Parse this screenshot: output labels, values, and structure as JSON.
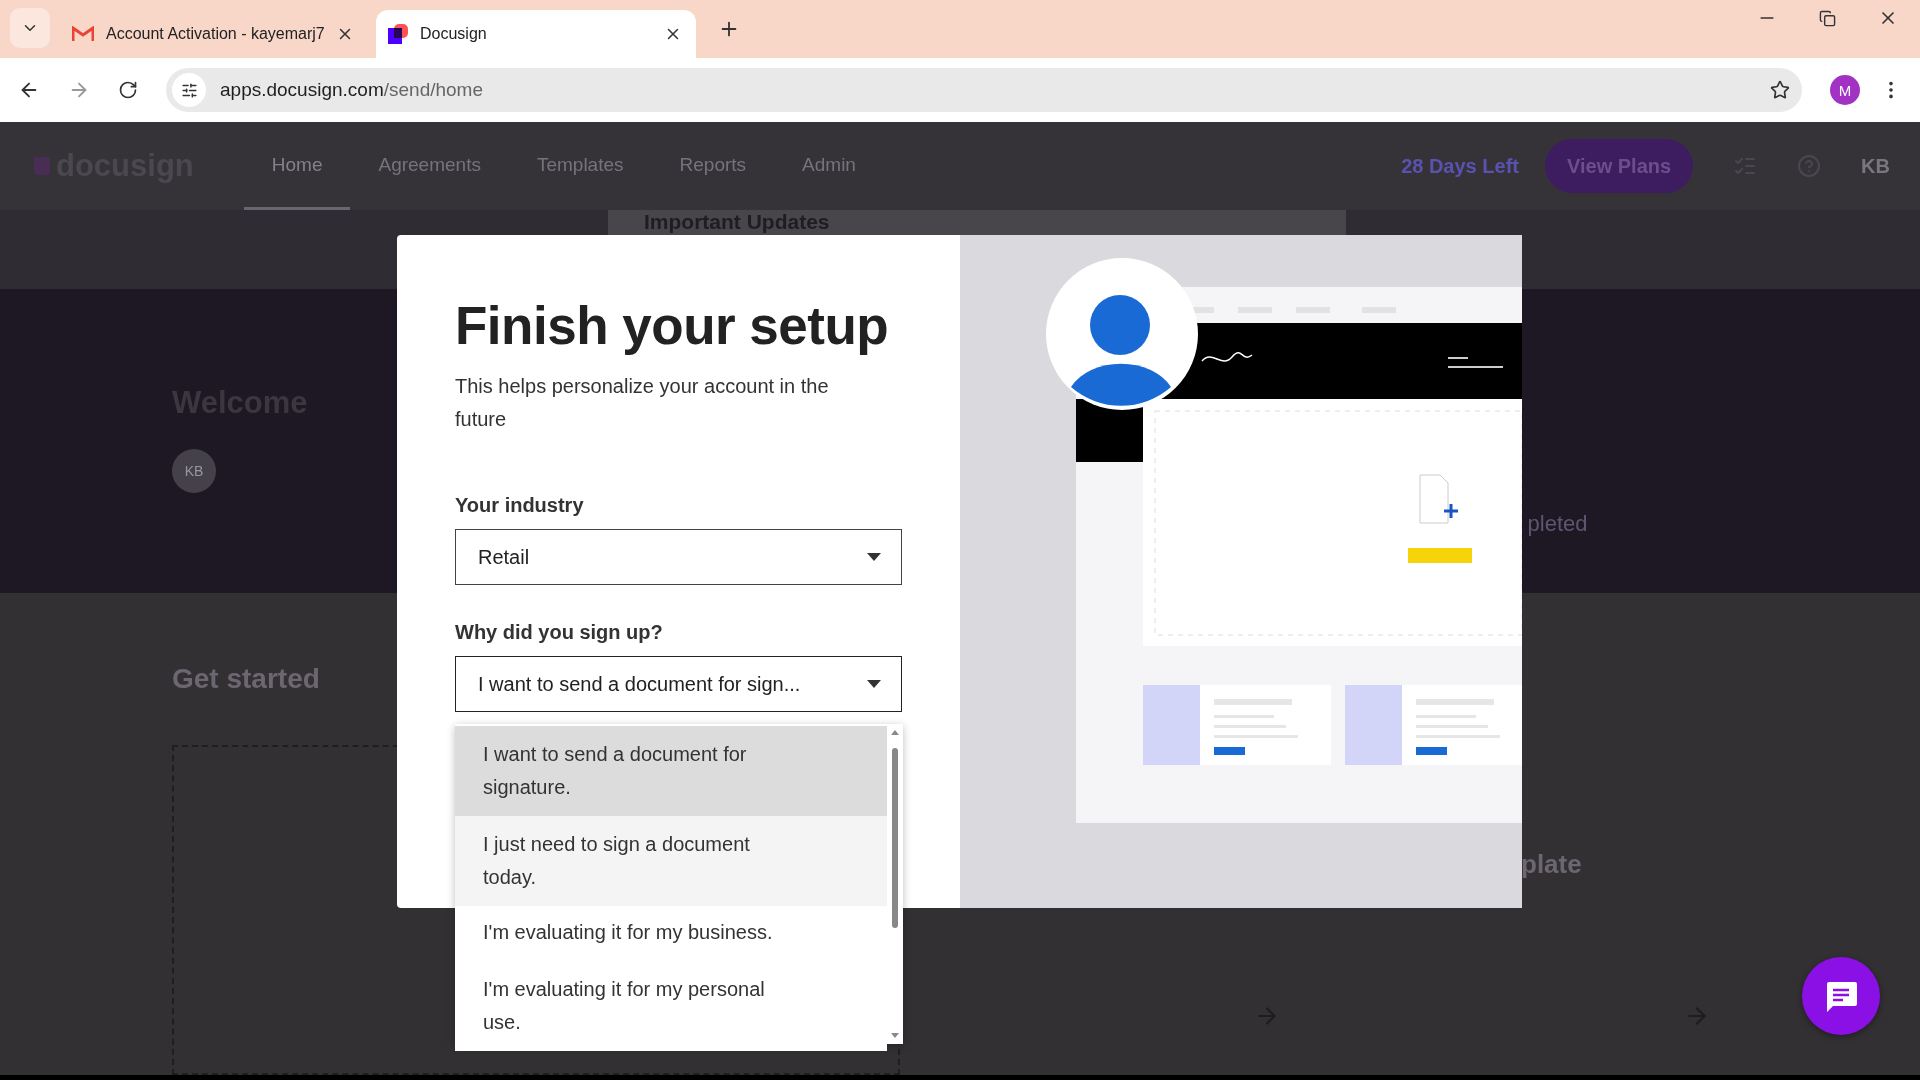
{
  "browser": {
    "tabs": [
      {
        "title": "Account Activation - kayemarj7",
        "selected": false
      },
      {
        "title": "Docusign",
        "selected": true
      }
    ],
    "url_host": "apps.docusign.com",
    "url_path": "/send/home",
    "profile_initial": "M"
  },
  "app": {
    "logo": "docusign",
    "nav": [
      {
        "label": "Home",
        "selected": true
      },
      {
        "label": "Agreements",
        "selected": false
      },
      {
        "label": "Templates",
        "selected": false
      },
      {
        "label": "Reports",
        "selected": false
      },
      {
        "label": "Admin",
        "selected": false
      }
    ],
    "trial_notice": "28 Days Left",
    "plans_button": "View Plans",
    "user_initials": "KB",
    "updates_title": "Important Updates",
    "welcome": "Welcome",
    "avatar_initials": "KB",
    "status_partial": "pleted",
    "get_started": "Get started",
    "card_title_partial": "plate"
  },
  "modal": {
    "title": "Finish your setup",
    "subtitle": "This helps personalize your account in the future",
    "fields": [
      {
        "label": "Your industry",
        "value": "Retail",
        "expanded": false
      },
      {
        "label": "Why did you sign up?",
        "value": "I want to send a document for sign...",
        "expanded": true
      }
    ],
    "options": [
      {
        "label": "I want to send a document for signature.",
        "selected": true
      },
      {
        "label": "I just need to sign a document today.",
        "selected": false
      },
      {
        "label": "I'm evaluating it for my business.",
        "selected": false
      },
      {
        "label": "I'm evaluating it for my personal use.",
        "selected": false
      }
    ]
  }
}
